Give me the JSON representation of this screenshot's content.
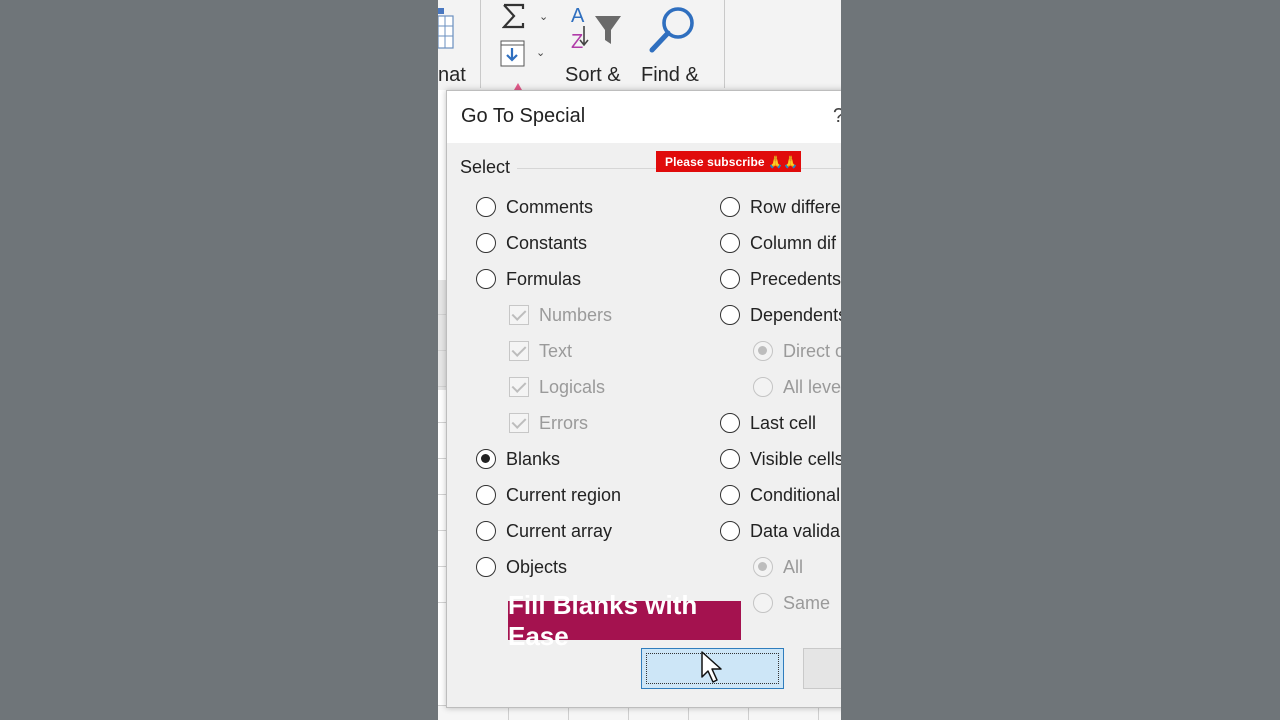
{
  "ribbon": {
    "format_label_partial": "nat",
    "sort_label": "Sort &",
    "find_label": "Find &",
    "icons": [
      "table-format-icon",
      "autosum-icon",
      "fill-down-icon",
      "sort-filter-icon",
      "find-magnifier-icon"
    ]
  },
  "dialog": {
    "title": "Go To Special",
    "help": "?",
    "section_label": "Select",
    "left_options": [
      {
        "label": "Comments",
        "checked": false
      },
      {
        "label": "Constants",
        "checked": false
      },
      {
        "label": "Formulas",
        "checked": false
      }
    ],
    "formula_subs": [
      {
        "label": "Numbers"
      },
      {
        "label": "Text"
      },
      {
        "label": "Logicals"
      },
      {
        "label": "Errors"
      }
    ],
    "left_options2": [
      {
        "label": "Blanks",
        "checked": true
      },
      {
        "label": "Current region",
        "checked": false
      },
      {
        "label": "Current array",
        "checked": false
      },
      {
        "label": "Objects",
        "checked": false
      }
    ],
    "right_options": [
      {
        "label": "Row differe"
      },
      {
        "label": "Column dif"
      },
      {
        "label": "Precedents"
      },
      {
        "label": "Dependents"
      },
      {
        "label": "Direct o"
      },
      {
        "label": "All leve"
      },
      {
        "label": "Last cell"
      },
      {
        "label": "Visible cells"
      },
      {
        "label": "Conditional"
      },
      {
        "label": "Data valida"
      },
      {
        "label": "All"
      },
      {
        "label": "Same"
      }
    ]
  },
  "overlay": {
    "subscribe_text": "Please subscribe 🙏🙏",
    "caption": "Fill Blanks with Ease"
  },
  "colors": {
    "subscribe_bg": "#e00b0b",
    "caption_bg": "#a4124f",
    "ok_button_bg": "#cde6f7",
    "ok_button_border": "#2f7dbd"
  }
}
